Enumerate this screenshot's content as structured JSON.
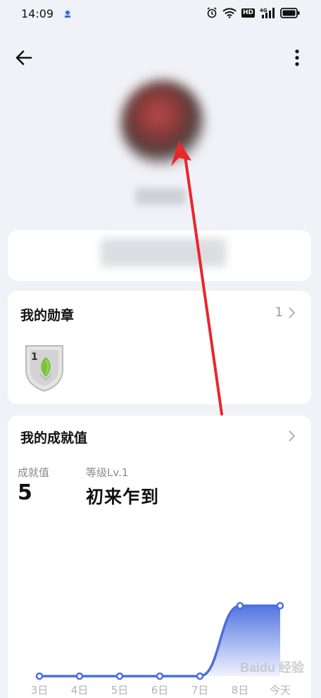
{
  "status_bar": {
    "time": "14:09",
    "icons": [
      "app-notification-icon",
      "alarm-icon",
      "wifi-icon",
      "hd-icon",
      "signal-4g-icon",
      "battery-icon"
    ],
    "hd_label": "HD",
    "network_label": "4G"
  },
  "header": {
    "back_icon": "arrow-left-icon",
    "more_icon": "more-vertical-icon"
  },
  "badges_section": {
    "title": "我的勋章",
    "count": "1",
    "medal_number": "1"
  },
  "achievement_section": {
    "title": "我的成就值",
    "score_label": "成就值",
    "score_value": "5",
    "level_label": "等级Lv.1",
    "level_name": "初来乍到"
  },
  "chart_data": {
    "type": "area",
    "categories": [
      "3日",
      "4日",
      "5日",
      "6日",
      "7日",
      "8日",
      "今天"
    ],
    "values": [
      0,
      0,
      0,
      0,
      0,
      5,
      5
    ],
    "color": "#4a6ee0"
  },
  "watermark": "Baidu 经验",
  "colors": {
    "background": "#f1f2f7",
    "card": "#ffffff",
    "accent": "#4a6ee0",
    "annotation_arrow": "#e8262c"
  }
}
